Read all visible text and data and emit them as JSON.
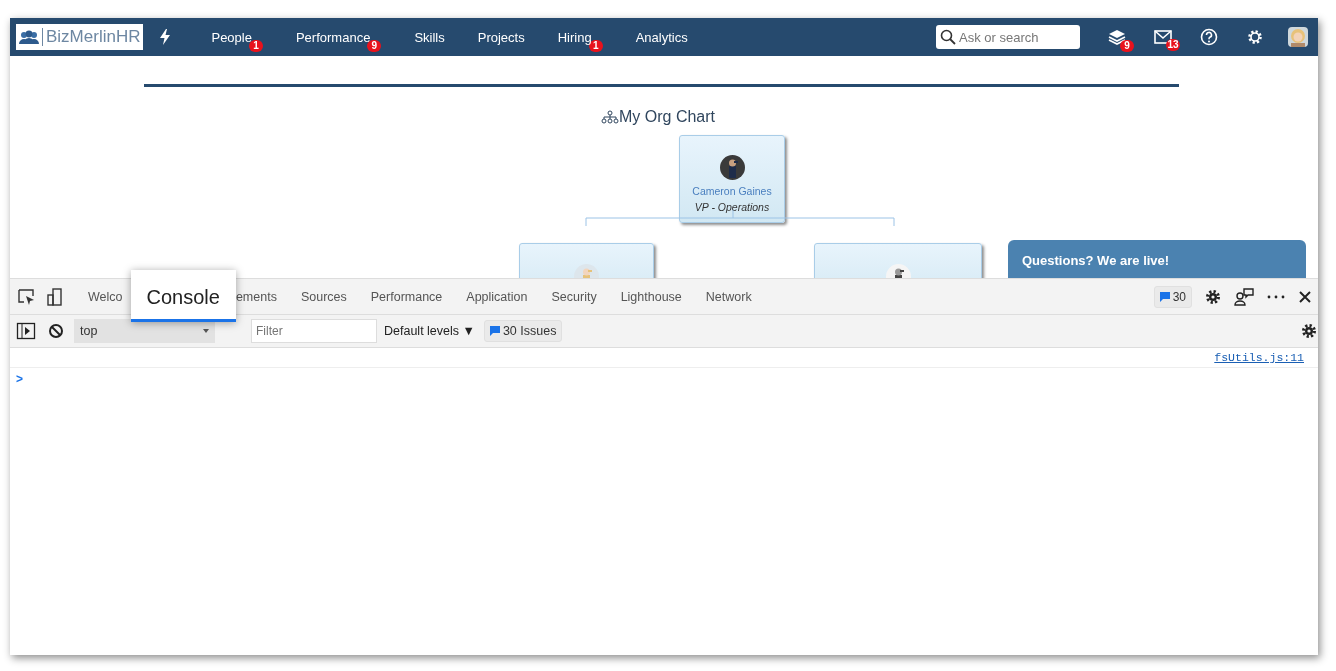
{
  "navbar": {
    "logo": "BizMerlinHR",
    "items": [
      {
        "label": "People",
        "badge": "1"
      },
      {
        "label": "Performance",
        "badge": "9"
      },
      {
        "label": "Skills"
      },
      {
        "label": "Projects"
      },
      {
        "label": "Hiring",
        "badge": "1"
      },
      {
        "label": "Analytics"
      }
    ],
    "search": {
      "placeholder": "Ask or search"
    },
    "icons": [
      {
        "kind": "layers",
        "badge": "9"
      },
      {
        "kind": "mail",
        "badge": "13"
      },
      {
        "kind": "help"
      },
      {
        "kind": "settings"
      },
      {
        "kind": "avatar"
      }
    ]
  },
  "org_chart": {
    "title": "My Org Chart",
    "root": {
      "name": "Cameron Gaines",
      "title": "VP - Operations"
    },
    "children": [
      {
        "kind": "partial"
      },
      {
        "kind": "partial"
      }
    ]
  },
  "chat_widget": {
    "title": "Questions? We are live!"
  },
  "devtools": {
    "tabs": [
      {
        "label": "Welco",
        "selected": false
      },
      {
        "label": "Console",
        "selected": true
      },
      {
        "label": "ements",
        "selected": false
      },
      {
        "label": "Sources",
        "selected": false
      },
      {
        "label": "Performance",
        "selected": false
      },
      {
        "label": "Application",
        "selected": false
      },
      {
        "label": "Security",
        "selected": false
      },
      {
        "label": "Lighthouse",
        "selected": false
      },
      {
        "label": "Network",
        "selected": false
      }
    ],
    "issues_count": "30",
    "toolbar": {
      "context": "top",
      "filter_placeholder": "Filter",
      "levels": "Default levels ▼",
      "issues": "30 Issues"
    },
    "console": {
      "source_link": "fsUtils.js:11",
      "prompt": ">"
    }
  }
}
